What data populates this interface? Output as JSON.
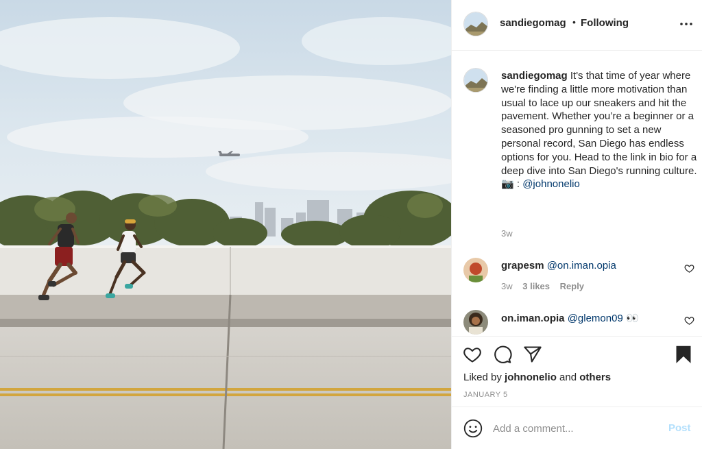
{
  "photo": {
    "alt": "Two runners on a bridge with San Diego skyline and an airplane"
  },
  "header": {
    "username": "sandiegomag",
    "separator": "•",
    "follow_status": "Following",
    "more_icon": "more-horizontal-icon"
  },
  "caption": {
    "username": "sandiegomag",
    "text": "It's that time of year where we're finding a little more motivation than usual to lace up our sneakers and hit the pavement. Whether you’re a beginner or a seasoned pro gunning to set a new personal record, San Diego has endless options for you. Head to the link in bio for a deep dive into San Diego's running culture.",
    "credit_icon": "📷",
    "credit_sep": " : ",
    "credit_mention": "@johnonelio",
    "time": "3w"
  },
  "comments": [
    {
      "username": "grapesm",
      "mention": "@on.iman.opia",
      "extra": "",
      "time": "3w",
      "likes": "3 likes",
      "reply": "Reply"
    },
    {
      "username": "on.iman.opia",
      "mention": "@glemon09",
      "extra": "👀",
      "time": "",
      "likes": "",
      "reply": ""
    }
  ],
  "actions": {
    "icons": [
      "heart-icon",
      "comment-icon",
      "share-icon",
      "bookmark-icon"
    ],
    "liked_prefix": "Liked by",
    "liked_user": "johnonelio",
    "liked_and": "and",
    "liked_others": "others",
    "date": "JANUARY 5"
  },
  "add_comment": {
    "placeholder": "Add a comment...",
    "post_label": "Post"
  },
  "colors": {
    "text": "#262626",
    "secondary": "#8e8e8e",
    "mention": "#00376b",
    "post_disabled": "#b2dffc",
    "border": "#efefef"
  }
}
